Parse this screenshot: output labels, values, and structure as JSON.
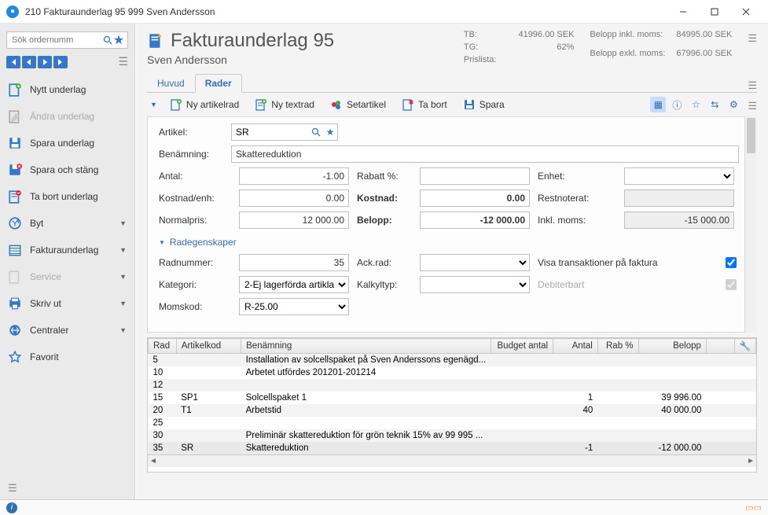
{
  "window": {
    "title": "210 Fakturaunderlag  95  999  Sven Andersson"
  },
  "sidebar": {
    "search_placeholder": "Sök ordernumm",
    "items": [
      {
        "label": "Nytt underlag",
        "disabled": false,
        "caret": false
      },
      {
        "label": "Ändra underlag",
        "disabled": true,
        "caret": false
      },
      {
        "label": "Spara underlag",
        "disabled": false,
        "caret": false
      },
      {
        "label": "Spara och stäng",
        "disabled": false,
        "caret": false
      },
      {
        "label": "Ta bort underlag",
        "disabled": false,
        "caret": false
      },
      {
        "label": "Byt",
        "disabled": false,
        "caret": true
      },
      {
        "label": "Fakturaunderlag",
        "disabled": false,
        "caret": true
      },
      {
        "label": "Service",
        "disabled": true,
        "caret": true
      },
      {
        "label": "Skriv ut",
        "disabled": false,
        "caret": true
      },
      {
        "label": "Centraler",
        "disabled": false,
        "caret": true
      },
      {
        "label": "Favorit",
        "disabled": false,
        "caret": false
      }
    ]
  },
  "header": {
    "title": "Fakturaunderlag 95",
    "subtitle": "Sven Andersson",
    "summary1": {
      "tb_label": "TB:",
      "tb_value": "41996.00 SEK",
      "tg_label": "TG:",
      "tg_value": "62%",
      "prislista_label": "Prislista:",
      "prislista_value": ""
    },
    "summary2": {
      "inkl_label": "Belopp inkl. moms:",
      "inkl_value": "84995.00 SEK",
      "exkl_label": "Belopp exkl. moms:",
      "exkl_value": "67996.00 SEK"
    }
  },
  "tabs": [
    {
      "label": "Huvud",
      "active": false
    },
    {
      "label": "Rader",
      "active": true
    }
  ],
  "toolbar": {
    "ny_artikelrad": "Ny artikelrad",
    "ny_textrad": "Ny textrad",
    "setartikel": "Setartikel",
    "ta_bort": "Ta bort",
    "spara": "Spara"
  },
  "form": {
    "artikel_label": "Artikel:",
    "artikel_value": "SR",
    "benamning_label": "Benämning:",
    "benamning_value": "Skattereduktion",
    "antal_label": "Antal:",
    "antal_value": "-1.00",
    "rabatt_label": "Rabatt %:",
    "rabatt_value": "",
    "enhet_label": "Enhet:",
    "enhet_value": "",
    "kostnadenh_label": "Kostnad/enh:",
    "kostnadenh_value": "0.00",
    "kostnad_label": "Kostnad:",
    "kostnad_value": "0.00",
    "restnoterat_label": "Restnoterat:",
    "restnoterat_value": "",
    "normalpris_label": "Normalpris:",
    "normalpris_value": "12 000.00",
    "belopp_label": "Belopp:",
    "belopp_value": "-12 000.00",
    "inklmoms_label": "Inkl. moms:",
    "inklmoms_value": "-15 000.00",
    "section_label": "Radegenskaper",
    "radnummer_label": "Radnummer:",
    "radnummer_value": "35",
    "ackrad_label": "Ack.rad:",
    "ackrad_value": "",
    "visa_label": "Visa transaktioner på faktura",
    "visa_checked": true,
    "kategori_label": "Kategori:",
    "kategori_value": "2-Ej lagerförda artikla",
    "kalkyltyp_label": "Kalkyltyp:",
    "kalkyltyp_value": "",
    "debiterbart_label": "Debiterbart",
    "debiterbart_checked": true,
    "momskod_label": "Momskod:",
    "momskod_value": "R-25.00"
  },
  "table": {
    "headers": [
      "Rad",
      "Artikelkod",
      "Benämning",
      "Budget antal",
      "Antal",
      "Rab %",
      "Belopp"
    ],
    "rows": [
      {
        "rad": "5",
        "kod": "",
        "ben": "Installation av solcellspaket på Sven Anderssons egenägd...",
        "budget": "",
        "antal": "",
        "rab": "",
        "belopp": ""
      },
      {
        "rad": "10",
        "kod": "",
        "ben": "Arbetet utfördes 201201-201214",
        "budget": "",
        "antal": "",
        "rab": "",
        "belopp": ""
      },
      {
        "rad": "12",
        "kod": "",
        "ben": "",
        "budget": "",
        "antal": "",
        "rab": "",
        "belopp": ""
      },
      {
        "rad": "15",
        "kod": "SP1",
        "ben": "Solcellspaket 1",
        "budget": "",
        "antal": "1",
        "rab": "",
        "belopp": "39 996.00"
      },
      {
        "rad": "20",
        "kod": "T1",
        "ben": "Arbetstid",
        "budget": "",
        "antal": "40",
        "rab": "",
        "belopp": "40 000.00"
      },
      {
        "rad": "25",
        "kod": "",
        "ben": "",
        "budget": "",
        "antal": "",
        "rab": "",
        "belopp": ""
      },
      {
        "rad": "30",
        "kod": "",
        "ben": "Preliminär skattereduktion för grön teknik 15% av 99 995 ...",
        "budget": "",
        "antal": "",
        "rab": "",
        "belopp": ""
      },
      {
        "rad": "35",
        "kod": "SR",
        "ben": "Skattereduktion",
        "budget": "",
        "antal": "-1",
        "rab": "",
        "belopp": "-12 000.00",
        "selected": true
      }
    ]
  }
}
